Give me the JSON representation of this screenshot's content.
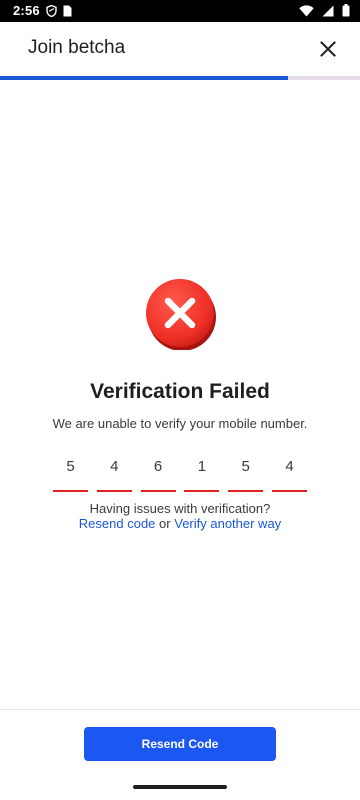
{
  "status_bar": {
    "time": "2:56"
  },
  "header": {
    "title": "Join betcha"
  },
  "progress": {
    "fraction": 0.8
  },
  "verification": {
    "title": "Verification Failed",
    "message": "We are unable to verify your mobile number.",
    "digits": [
      "5",
      "4",
      "6",
      "1",
      "5",
      "4"
    ],
    "help_question": "Having issues with verification?",
    "resend_link": "Resend code",
    "or_text": "or",
    "verify_link": "Verify another way"
  },
  "footer": {
    "resend_button": "Resend Code"
  },
  "colors": {
    "accent": "#1b57d6",
    "button": "#1b57f0",
    "error": "#e02424"
  }
}
